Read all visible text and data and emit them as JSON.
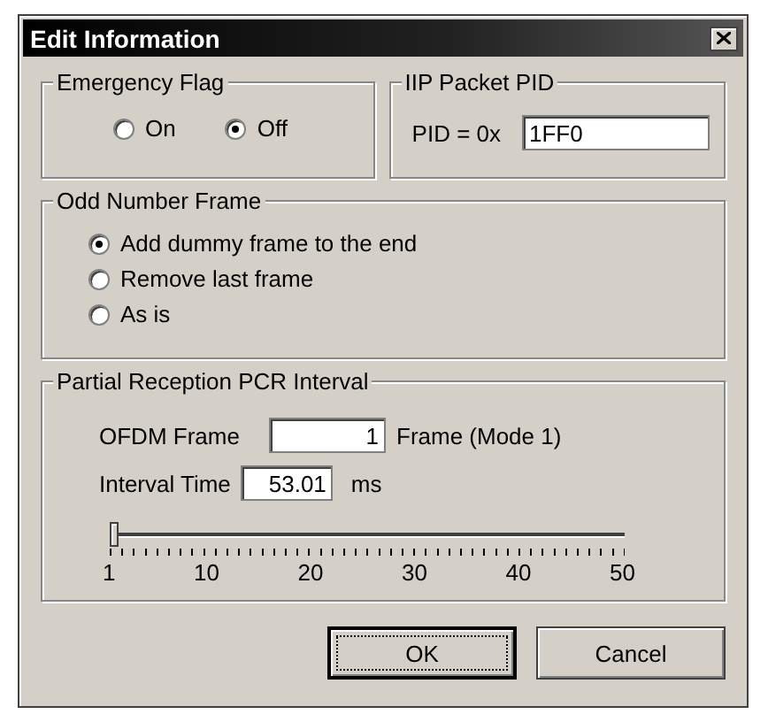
{
  "window": {
    "title": "Edit Information"
  },
  "emergency_flag": {
    "label": "Emergency Flag",
    "options": [
      {
        "label": "On",
        "selected": false
      },
      {
        "label": "Off",
        "selected": true
      }
    ]
  },
  "iip_packet_pid": {
    "label": "IIP Packet PID",
    "prefix": "PID = 0x",
    "value": "1FF0"
  },
  "odd_number_frame": {
    "label": "Odd Number Frame",
    "options": [
      {
        "label": "Add dummy frame to the end",
        "selected": true
      },
      {
        "label": "Remove last frame",
        "selected": false
      },
      {
        "label": "As is",
        "selected": false
      }
    ]
  },
  "partial_reception_pcr_interval": {
    "label": "Partial Reception PCR Interval",
    "ofdm_frame": {
      "label": "OFDM Frame",
      "value": "1",
      "unit": "Frame (Mode 1)"
    },
    "interval_time": {
      "label": "Interval Time",
      "value": "53.01",
      "unit": "ms"
    },
    "slider": {
      "level": 0,
      "labels": [
        "1",
        "10",
        "20",
        "30",
        "40",
        "50"
      ]
    }
  },
  "buttons": [
    {
      "label": "OK",
      "focused": true
    },
    {
      "label": "Cancel",
      "focused": false
    }
  ]
}
